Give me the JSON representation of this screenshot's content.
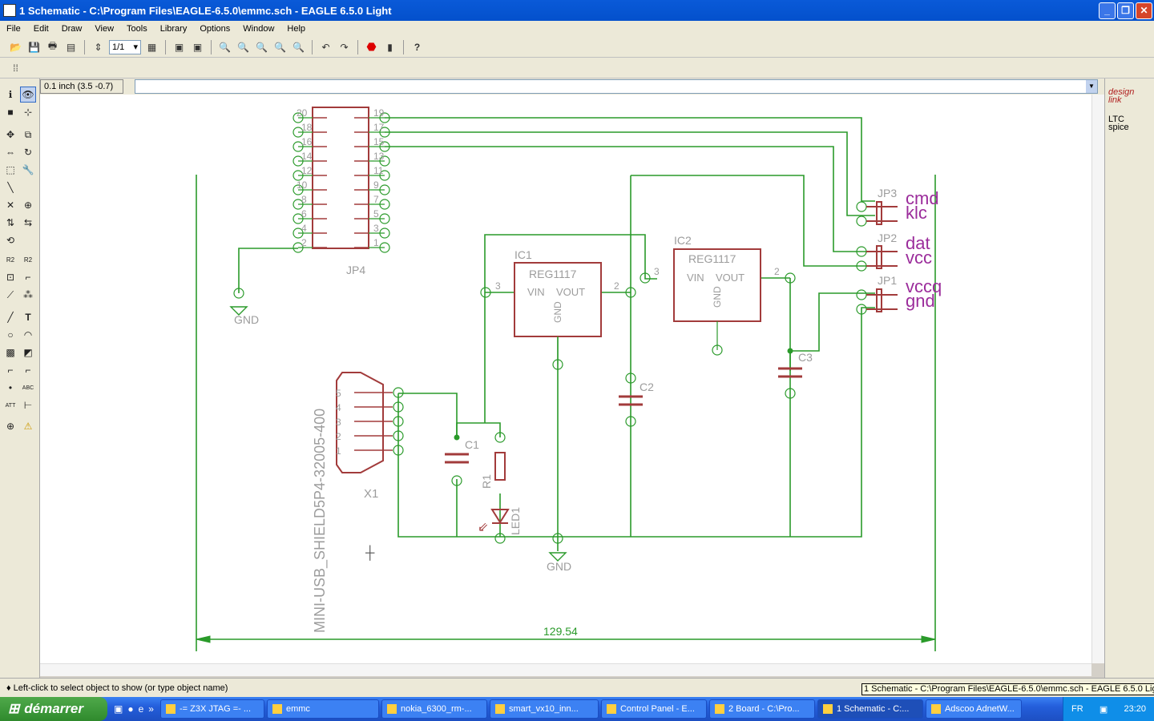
{
  "window": {
    "title": "1 Schematic - C:\\Program Files\\EAGLE-6.5.0\\emmc.sch - EAGLE 6.5.0 Light"
  },
  "menu": [
    "File",
    "Edit",
    "Draw",
    "View",
    "Tools",
    "Library",
    "Options",
    "Window",
    "Help"
  ],
  "toolbar": {
    "sheet_combo": "1/1"
  },
  "coords": "0.1 inch (3.5 -0.7)",
  "right_panel": {
    "designlink": "design link",
    "ltc_spice": "LTC spice"
  },
  "status": "♦ Left-click to select object to show (or type object name)",
  "tooltip": "1 Schematic - C:\\Program Files\\EAGLE-6.5.0\\emmc.sch - EAGLE 6.5.0 Light",
  "schematic": {
    "jp4": "JP4",
    "jp4_pins_left": [
      "20",
      "18",
      "16",
      "14",
      "12",
      "10",
      "8",
      "6",
      "4",
      "2"
    ],
    "jp4_pins_right": [
      "19",
      "17",
      "15",
      "13",
      "11",
      "9",
      "7",
      "5",
      "3",
      "1"
    ],
    "ic1": "IC1",
    "ic2": "IC2",
    "reg": "REG1117",
    "vin": "VIN",
    "vout": "VOUT",
    "gnd_pin": "GND",
    "c1": "C1",
    "c2": "C2",
    "c3": "C3",
    "r1": "R1",
    "led1": "LED1",
    "x1": "X1",
    "usb_part": "MINI-USB_SHIELD5P4-32005-400",
    "usb_pins": [
      "5",
      "4",
      "3",
      "2",
      "1"
    ],
    "jp3": "JP3",
    "jp2": "JP2",
    "jp1": "JP1",
    "net_labels": [
      "cmd",
      "klc",
      "dat",
      "vcc",
      "vccq",
      "gnd"
    ],
    "gnd_symbol": "GND",
    "dimension": "129.54",
    "pin_n3": "3",
    "pin_n2": "2",
    "pin_n1": "1"
  },
  "taskbar": {
    "start": "démarrer",
    "tasks": [
      "-= Z3X JTAG =- ...",
      "emmc",
      "nokia_6300_rm-...",
      "smart_vx10_inn...",
      "Control Panel - E...",
      "2 Board - C:\\Pro...",
      "1 Schematic - C:...",
      "Adscoo AdnetW..."
    ],
    "lang": "FR",
    "clock": "23:20"
  }
}
